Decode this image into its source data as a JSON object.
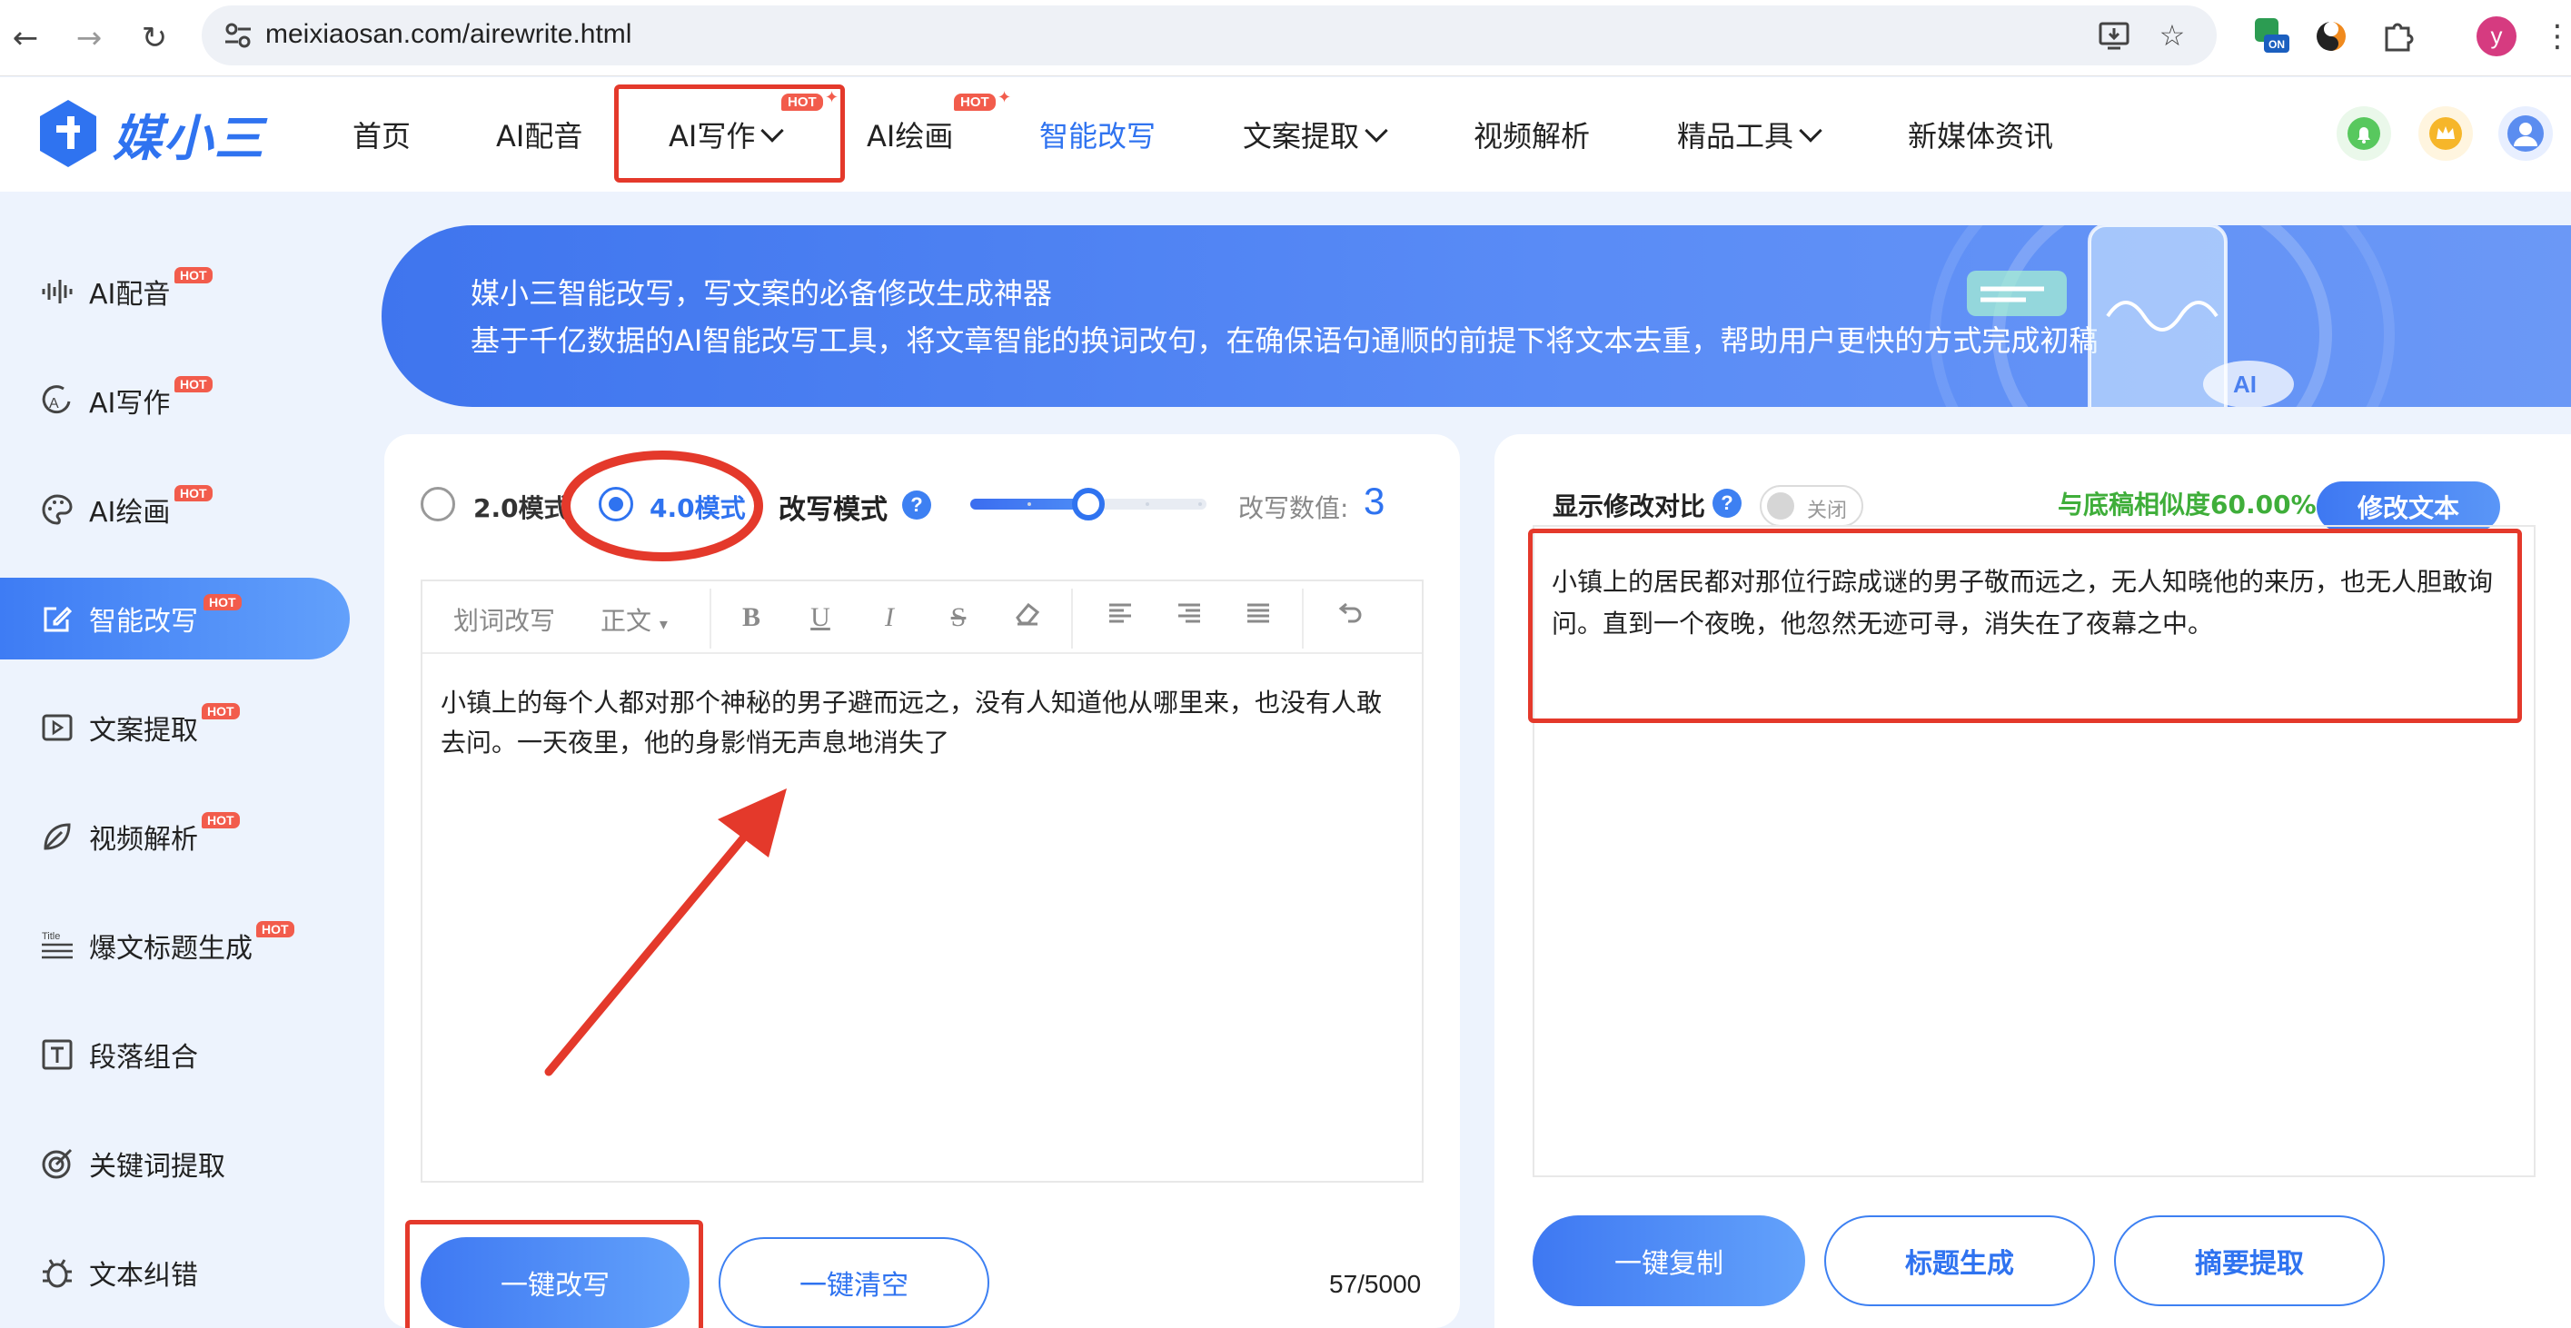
{
  "browser": {
    "url": "meixiaosan.com/airewrite.html",
    "profile_initial": "y",
    "extension_badge": "ON"
  },
  "site": {
    "logo_text": "媒小三",
    "hot_badge": "HOT",
    "nav": [
      {
        "label": "首页"
      },
      {
        "label": "AI配音"
      },
      {
        "label": "AI写作"
      },
      {
        "label": "AI绘画"
      },
      {
        "label": "智能改写"
      },
      {
        "label": "文案提取"
      },
      {
        "label": "视频解析"
      },
      {
        "label": "精品工具"
      },
      {
        "label": "新媒体资讯"
      }
    ]
  },
  "sidebar": {
    "items": [
      {
        "label": "AI配音",
        "hot": true
      },
      {
        "label": "AI写作",
        "hot": true
      },
      {
        "label": "AI绘画",
        "hot": true
      },
      {
        "label": "智能改写",
        "hot": true
      },
      {
        "label": "文案提取",
        "hot": true
      },
      {
        "label": "视频解析",
        "hot": true
      },
      {
        "label": "爆文标题生成",
        "hot": true
      },
      {
        "label": "段落组合",
        "hot": false
      },
      {
        "label": "关键词提取",
        "hot": false
      },
      {
        "label": "文本纠错",
        "hot": false
      }
    ],
    "title_icon_text": "Title"
  },
  "banner": {
    "line1": "媒小三智能改写，写文案的必备修改生成神器",
    "line2": "基于千亿数据的AI智能改写工具，将文章智能的换词改句，在确保语句通顺的前提下将文本去重，帮助用户更快的方式完成初稿",
    "deco_text": "AI"
  },
  "left": {
    "mode_20": "2.0模式",
    "mode_40": "4.0模式",
    "selected_mode": "4.0模式",
    "rewrite_mode_label": "改写模式",
    "help": "?",
    "rewrite_value_label": "改写数值:",
    "rewrite_value": "3",
    "slider_level": 3,
    "slider_max": 5,
    "toolbar": {
      "word_rewrite": "划词改写",
      "format": "正文"
    },
    "input_text": "小镇上的每个人都对那个神秘的男子避而远之，没有人知道他从哪里来，也没有人敢去问。一天夜里，他的身影悄无声息地消失了",
    "btn_rewrite": "一键改写",
    "btn_clear": "一键清空",
    "counter": "57/5000"
  },
  "right": {
    "compare_label": "显示修改对比",
    "help": "?",
    "toggle_label": "关闭",
    "similarity": "与底稿相似度60.00%",
    "btn_modify": "修改文本",
    "result_text": "小镇上的居民都对那位行踪成谜的男子敬而远之，无人知晓他的来历，也无人胆敢询问。直到一个夜晚，他忽然无迹可寻，消失在了夜幕之中。",
    "btn_copy": "一键复制",
    "btn_title": "标题生成",
    "btn_summary": "摘要提取"
  },
  "colors": {
    "brand": "#2f73f0",
    "highlight": "#e4392b",
    "similarity": "#3fae3a",
    "hot": "#f25c4c"
  }
}
